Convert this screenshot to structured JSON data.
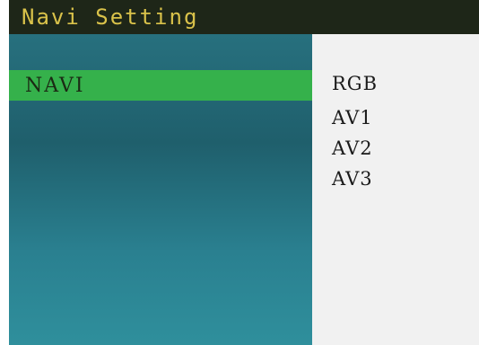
{
  "header": {
    "title": "Navi Setting"
  },
  "menu": {
    "items": [
      {
        "label": "NAVI",
        "selected": true
      }
    ]
  },
  "options": {
    "items": [
      {
        "label": "RGB"
      },
      {
        "label": "AV1"
      },
      {
        "label": "AV2"
      },
      {
        "label": "AV3"
      }
    ]
  },
  "colors": {
    "title_bg": "#1e2618",
    "title_text": "#d9c24a",
    "menu_selected_bg": "#35b14b",
    "panel_bg": "#27707e",
    "options_bg": "#f1f1f1"
  }
}
